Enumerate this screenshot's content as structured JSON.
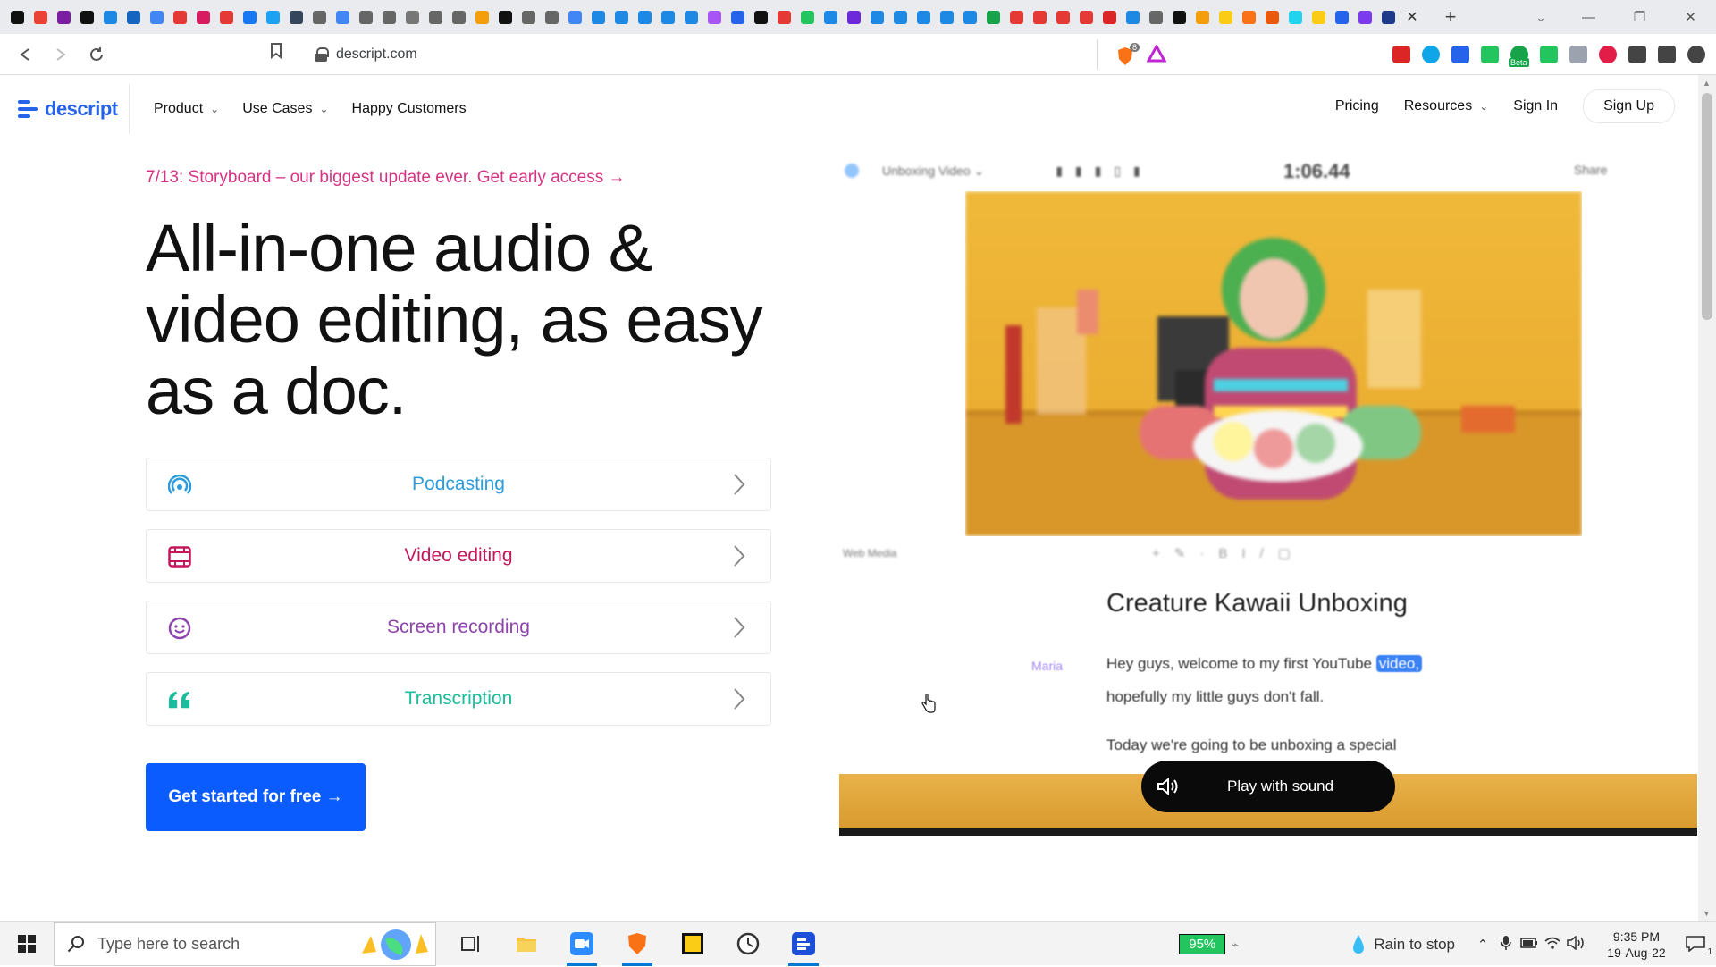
{
  "browser": {
    "favicon_colors": [
      "#111111",
      "#ea4335",
      "#7b1fa2",
      "#111111",
      "#1e88e5",
      "#1565c0",
      "#4285f4",
      "#e53935",
      "#d81b60",
      "#e53935",
      "#1877f2",
      "#1da1f2",
      "#35465c",
      "#666666",
      "#4285f4",
      "#666666",
      "#666666",
      "#777777",
      "#666666",
      "#666666",
      "#f59e0b",
      "#111111",
      "#666666",
      "#666666",
      "#4285f4",
      "#1e88e5",
      "#1e88e5",
      "#1e88e5",
      "#1e88e5",
      "#1e88e5",
      "#a855f7",
      "#2563eb",
      "#111111",
      "#e53935",
      "#22c55e",
      "#1e88e5",
      "#6d28d9",
      "#1e88e5",
      "#1e88e5",
      "#1e88e5",
      "#1e88e5",
      "#1e88e5",
      "#16a34a",
      "#e53935",
      "#e53935",
      "#e53935",
      "#e53935",
      "#dc2626",
      "#1e88e5",
      "#666666",
      "#111111",
      "#f59e0b",
      "#facc15",
      "#f97316",
      "#ea580c",
      "#22d3ee",
      "#facc15",
      "#2563eb",
      "#7c3aed",
      "#1e3a8a"
    ],
    "tab_close_glyph": "✕",
    "new_tab_glyph": "+",
    "tab_search_glyph": "⌄",
    "window": {
      "minimize": "—",
      "restore": "❐",
      "close": "✕"
    },
    "url": "descript.com",
    "extensions": [
      "#dc2626",
      "#0ea5e9",
      "#2563eb",
      "#22c55e",
      "#16a34a",
      "#22c55e",
      "#9ca3af",
      "#e11d48",
      "#444444",
      "#444444",
      "#444444"
    ],
    "extension_badge": "Beta",
    "brave_badge": "8"
  },
  "site": {
    "logo_text": "descript",
    "nav": {
      "product": "Product",
      "use_cases": "Use Cases",
      "happy_customers": "Happy Customers"
    },
    "right_nav": {
      "pricing": "Pricing",
      "resources": "Resources",
      "sign_in": "Sign In",
      "sign_up": "Sign Up"
    },
    "announcement": "7/13: Storyboard – our biggest update ever. Get early access →",
    "hero_title": "All-in-one audio & video editing, as easy as a doc.",
    "use_cases": [
      {
        "label": "Podcasting",
        "color": "#2d9cdb",
        "icon": "podcast-icon"
      },
      {
        "label": "Video editing",
        "color": "#c2185b",
        "icon": "film-icon"
      },
      {
        "label": "Screen recording",
        "color": "#8e44ad",
        "icon": "smiley-icon"
      },
      {
        "label": "Transcription",
        "color": "#1abc9c",
        "icon": "quote-icon"
      }
    ],
    "cta": "Get started for free →",
    "accent": "#0b5cff"
  },
  "preview": {
    "toolbar_title": "Unboxing Video ⌄",
    "timecode": "1:06.44",
    "toolbar_right": "Share",
    "sub_label": "Web Media",
    "doc_title": "Creature Kawaii Unboxing",
    "speaker": "Maria",
    "line1_before": "Hey guys, welcome to my first YouTube",
    "line1_highlight": "video,",
    "line2": "hopefully my little guys don't fall.",
    "line3": "Today we're going to be unboxing a special",
    "play_label": "Play with sound"
  },
  "taskbar": {
    "search_placeholder": "Type here to search",
    "battery": "95%",
    "weather": "Rain to stop",
    "time": "9:35 PM",
    "date": "19-Aug-22",
    "notification_count": "1"
  }
}
